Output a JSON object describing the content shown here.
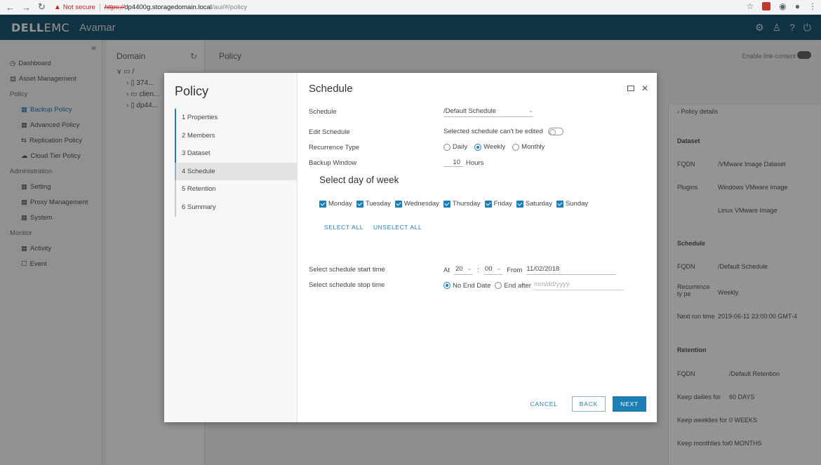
{
  "browser": {
    "not_secure": "Not secure",
    "url_protocol": "https://",
    "url_host": "dp4400g.storagedomain.local",
    "url_path": "/aui/#/policy"
  },
  "app": {
    "logo_bold": "DELL",
    "logo_light": "EMC",
    "product": "Avamar"
  },
  "sidebar": {
    "items": [
      "Dashboard",
      "Asset Management"
    ],
    "policy_section": "Policy",
    "policy_items": [
      "Backup Policy",
      "Advanced Policy",
      "Replication Policy",
      "Cloud Tier Policy"
    ],
    "admin_section": "Administration",
    "admin_items": [
      "Setting",
      "Proxy Management",
      "System"
    ],
    "monitor_section": "Monitor",
    "monitor_items": [
      "Activity",
      "Event"
    ]
  },
  "domain_pane": {
    "title": "Domain",
    "tree": [
      "/",
      "374...",
      "clien...",
      "dp44..."
    ]
  },
  "policy_pane": {
    "title": "Policy",
    "toggle_label": "Enable link-content"
  },
  "detail": {
    "header": "Policy details",
    "dataset_section": "Dataset",
    "fqdn_label": "FQDN",
    "dataset_value": "/VMware Image Dataset",
    "plugins_label": "Plugins",
    "plugins_value_1": "Windows VMware Image",
    "plugins_value_2": "Linux VMware Image",
    "schedule_section": "Schedule",
    "schedule_fqdn": "/Default Schedule",
    "recurrence_label": "Recurrence ty pe",
    "recurrence_value": "Weekly",
    "next_run_label": "Next run time",
    "next_run_value": "2019-06-11 23:00:00 GMT-4",
    "retention_section": "Retention",
    "retention_fqdn": "/Default Retention",
    "keep_dailies_label": "Keep dailies for",
    "keep_dailies_value": "60 DAYS",
    "keep_weeklies_label": "Keep weeklies for",
    "keep_weeklies_value": "0 WEEKS",
    "keep_monthlies_label": "Keep monthlies for",
    "keep_monthlies_value": "0 MONTHS"
  },
  "wizard": {
    "title": "Policy",
    "steps": [
      "1 Properties",
      "2 Members",
      "3 Dataset",
      "4 Schedule",
      "5 Retention",
      "6 Summary"
    ]
  },
  "schedule": {
    "title": "Schedule",
    "schedule_label": "Schedule",
    "schedule_value": "/Default Schedule",
    "edit_label": "Edit Schedule",
    "edit_note": "Selected schedule can't be edited",
    "recurrence_label": "Recurrence Type",
    "recurrence_options": [
      "Daily",
      "Weekly",
      "Monthly"
    ],
    "backup_window_label": "Backup Window",
    "backup_window_value": "10",
    "backup_window_unit": "Hours",
    "dow_title": "Select day of week",
    "days": [
      "Monday",
      "Tuesday",
      "Wednesday",
      "Thursday",
      "Friday",
      "Saturday",
      "Sunday"
    ],
    "select_all": "SELECT ALL",
    "unselect_all": "UNSELECT ALL",
    "start_label": "Select schedule start time",
    "at_label": "At",
    "hour": "20",
    "colon": ":",
    "minute": "00",
    "from_label": "From",
    "from_date": "11/02/2018",
    "stop_label": "Select schedule stop time",
    "no_end": "No End Date",
    "end_after": "End after",
    "end_placeholder": "mm/dd/yyyy"
  },
  "footer": {
    "cancel": "CANCEL",
    "back": "BACK",
    "next": "NEXT"
  }
}
